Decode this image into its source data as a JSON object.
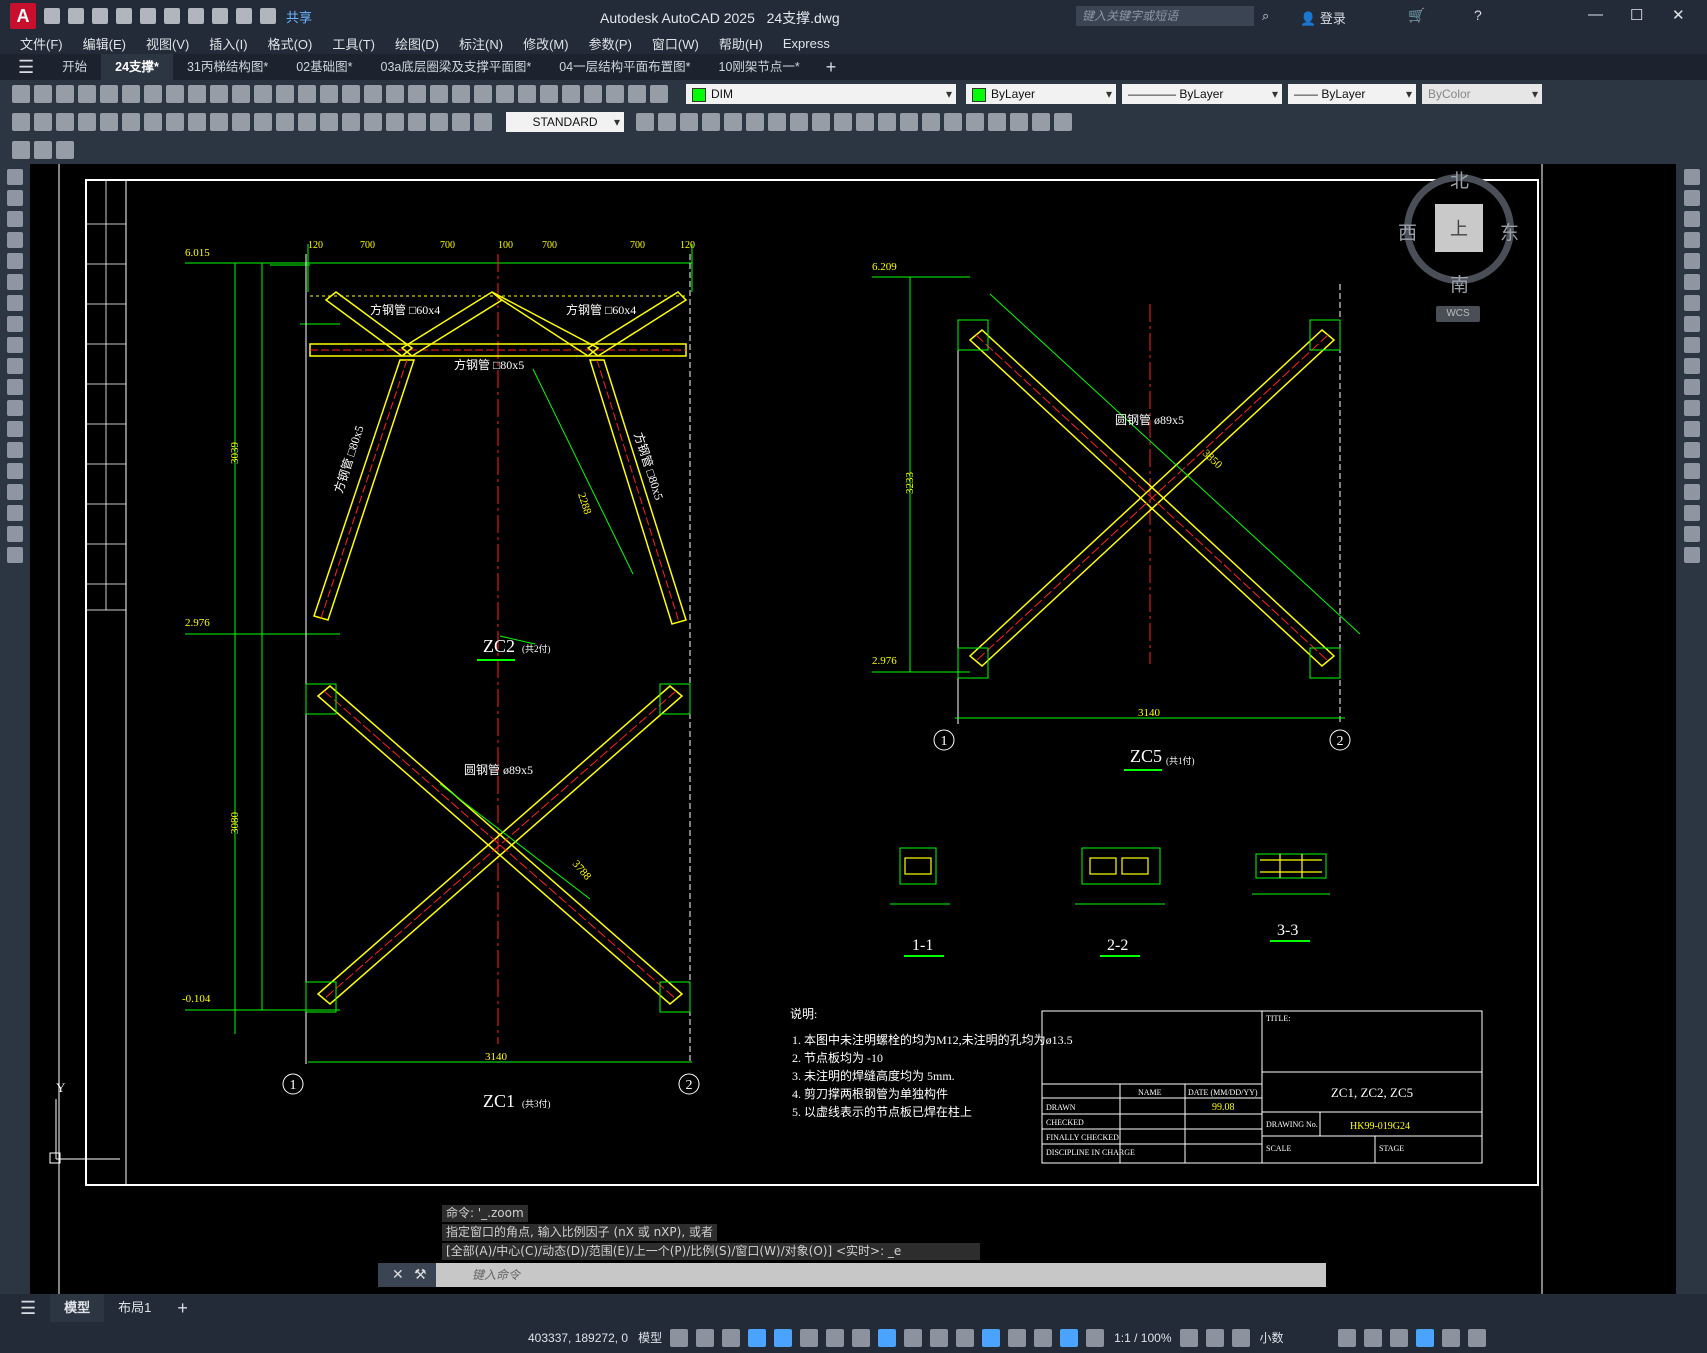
{
  "window": {
    "app_title": "Autodesk AutoCAD 2025",
    "file_title": "24支撑.dwg",
    "search_placeholder": "键入关键字或短语",
    "login_label": "登录",
    "share_label": "共享"
  },
  "menu": [
    "文件(F)",
    "编辑(E)",
    "视图(V)",
    "插入(I)",
    "格式(O)",
    "工具(T)",
    "绘图(D)",
    "标注(N)",
    "修改(M)",
    "参数(P)",
    "窗口(W)",
    "帮助(H)",
    "Express"
  ],
  "tabs": [
    {
      "label": "开始",
      "active": false
    },
    {
      "label": "24支撑*",
      "active": true
    },
    {
      "label": "31丙梯结构图*",
      "active": false
    },
    {
      "label": "02基础图*",
      "active": false
    },
    {
      "label": "03a底层圈梁及支撑平面图*",
      "active": false
    },
    {
      "label": "04一层结构平面布置图*",
      "active": false
    },
    {
      "label": "10刚架节点一*",
      "active": false
    }
  ],
  "toolbar": {
    "layer": "DIM",
    "color": "ByLayer",
    "linetype": "ByLayer",
    "lineweight": "ByLayer",
    "plotstyle": "ByColor",
    "textstyle": "STANDARD"
  },
  "viewcube": {
    "north": "北",
    "south": "南",
    "east": "东",
    "west": "西",
    "face": "上",
    "wcs": "WCS"
  },
  "drawing": {
    "levels": [
      "6.015",
      "2.976",
      "-0.104",
      "6.209",
      "2.976"
    ],
    "top_dims": [
      "120",
      "700",
      "700",
      "100",
      "700",
      "700",
      "120"
    ],
    "zc2_title": "ZC2",
    "zc2_sub": "(共2付)",
    "zc1_title": "ZC1",
    "zc1_sub": "(共3付)",
    "zc5_title": "ZC5",
    "zc5_sub": "(共1付)",
    "labels_sq60": "方钢管 □60x4",
    "label_sq80": "方钢管 □80x5",
    "label_sq80_v": "方钢管 □80x5",
    "label_round": "圆钢管 ø89x5",
    "dim_3039": "3039",
    "dim_3080": "3080",
    "dim_3233": "3233",
    "dim_3140": "3140",
    "dim_3788": "3788",
    "dim_3850": "3850",
    "dim_2288": "2288",
    "axis1": "1",
    "axis2": "2",
    "sec11": "1-1",
    "sec22": "2-2",
    "sec33": "3-3",
    "notes_title": "说明:",
    "notes": [
      "1. 本图中未注明螺栓的均为M12,未注明的孔均为ø13.5",
      "2. 节点板均为 -10",
      "3. 未注明的焊缝高度均为 5mm.",
      "4. 剪刀撑两根钢管为单独构件",
      "5. 以虚线表示的节点板已焊在柱上"
    ],
    "titleblock": {
      "title_label": "TITLE:",
      "title_value": "ZC1, ZC2, ZC5",
      "name_col": "NAME",
      "date_col": "DATE (MM/DD/YY)",
      "drawn": "DRAWN",
      "date_value": "99.08",
      "checked": "CHECKED",
      "finally_checked": "FINALLY CHECKED",
      "discipline": "DISCIPLINE IN CHARGE",
      "drawing_no_label": "DRAWING No.",
      "drawing_no": "HK99-019G24",
      "scale": "SCALE",
      "stage": "STAGE"
    }
  },
  "command": {
    "history": [
      "命令: '_.zoom",
      "指定窗口的角点, 输入比例因子 (nX 或 nXP), 或者",
      "[全部(A)/中心(C)/动态(D)/范围(E)/上一个(P)/比例(S)/窗口(W)/对象(O)] <实时>: _e"
    ],
    "placeholder": "键入命令"
  },
  "layout_tabs": [
    {
      "label": "模型",
      "active": true
    },
    {
      "label": "布局1",
      "active": false
    }
  ],
  "status": {
    "coords": "403337, 189272, 0",
    "model": "模型",
    "scale": "1:1 / 100%",
    "units": "小数"
  },
  "colors": {
    "accent": "#4aa3ff",
    "canvas": "#000000",
    "dims": "#00ff00",
    "member": "#ffff00",
    "center": "#ff2020"
  }
}
